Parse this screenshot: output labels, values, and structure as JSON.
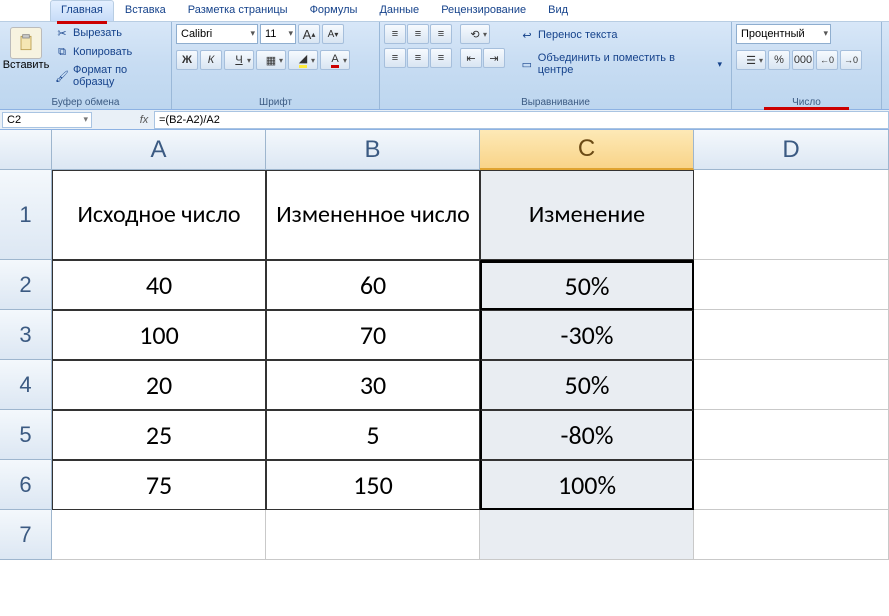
{
  "tabs": [
    "Главная",
    "Вставка",
    "Разметка страницы",
    "Формулы",
    "Данные",
    "Рецензирование",
    "Вид"
  ],
  "active_tab": "Главная",
  "clipboard": {
    "paste": "Вставить",
    "cut": "Вырезать",
    "copy": "Копировать",
    "format_painter": "Формат по образцу",
    "group": "Буфер обмена"
  },
  "font": {
    "name": "Calibri",
    "size": "11",
    "group": "Шрифт",
    "bold": "Ж",
    "italic": "К",
    "underline": "Ч",
    "grow": "A",
    "shrink": "A"
  },
  "alignment": {
    "wrap": "Перенос текста",
    "merge": "Объединить и поместить в центре",
    "group": "Выравнивание"
  },
  "number": {
    "format": "Процентный",
    "group": "Число"
  },
  "name_box": "C2",
  "formula": "=(B2-A2)/A2",
  "columns": [
    "A",
    "B",
    "C",
    "D"
  ],
  "rows": [
    {
      "n": "1",
      "a": "Исходное число",
      "b": "Измененное число",
      "c": "Изменение",
      "d": ""
    },
    {
      "n": "2",
      "a": "40",
      "b": "60",
      "c": "50%",
      "d": ""
    },
    {
      "n": "3",
      "a": "100",
      "b": "70",
      "c": "-30%",
      "d": ""
    },
    {
      "n": "4",
      "a": "20",
      "b": "30",
      "c": "50%",
      "d": ""
    },
    {
      "n": "5",
      "a": "25",
      "b": "5",
      "c": "-80%",
      "d": ""
    },
    {
      "n": "6",
      "a": "75",
      "b": "150",
      "c": "100%",
      "d": ""
    },
    {
      "n": "7",
      "a": "",
      "b": "",
      "c": "",
      "d": ""
    }
  ]
}
